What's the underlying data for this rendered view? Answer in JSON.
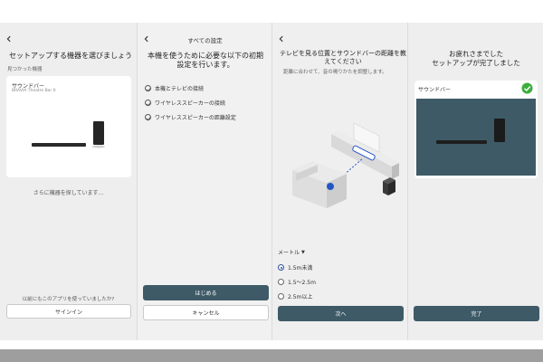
{
  "screen1": {
    "back_icon": "arrow-left-icon",
    "title": "セットアップする機器を選びましょう",
    "found_label": "見つかった機器",
    "device_name": "サウンドバー",
    "device_model": "BRAVIA Theatre Bar 6",
    "searching_text": "さらに機器を探しています...",
    "used_app_text": "以前にもこのアプリを使っていましたか?",
    "signin_label": "サインイン"
  },
  "screen2": {
    "back_icon": "arrow-left-icon",
    "header": "すべての設定",
    "title": "本機を使うために必要な以下の初期設定を行います。",
    "steps": [
      "本機とテレビの接続",
      "ワイヤレススピーカーの接続",
      "ワイヤレススピーカーの距離設定"
    ],
    "start_label": "はじめる",
    "cancel_label": "キャンセル"
  },
  "screen3": {
    "back_icon": "arrow-left-icon",
    "title": "テレビを見る位置とサウンドバーの距離を教えてください",
    "subtitle": "距離に合わせて、音の鳴りかたを調整します。",
    "unit_label": "メートル",
    "unit_dropdown_icon": "caret-down-icon",
    "options": [
      "1.5m未満",
      "1.5〜2.5m",
      "2.5m以上"
    ],
    "selected_index": 0,
    "next_label": "次へ"
  },
  "screen4": {
    "title": "お疲れさまでした\nセットアップが完了しました",
    "device_name": "サウンドバー",
    "check_icon": "check-circle-icon",
    "done_label": "完了"
  },
  "colors": {
    "accent_dark": "#3e5a67",
    "check_green": "#3cae3c",
    "radio_blue": "#2f4f9a",
    "marker_blue": "#2456c4"
  }
}
